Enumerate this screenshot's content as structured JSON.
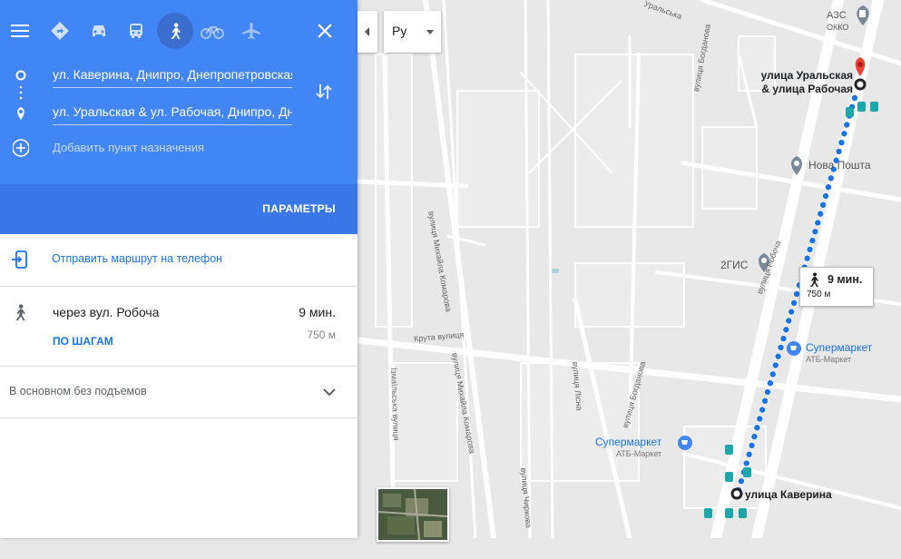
{
  "modes": [
    "directions-icon",
    "car-icon",
    "transit-icon",
    "walk-icon",
    "bike-icon",
    "flight-icon"
  ],
  "route": {
    "origin": "ул. Каверина, Днипро, Днепропетровская",
    "destination": "ул. Уральская & ул. Рабочая, Днипро, Днепропетровская",
    "add_destination": "Добавить пункт назначения",
    "params_label": "ПАРАМЕТРЫ"
  },
  "send": {
    "label": "Отправить маршрут на телефон"
  },
  "result": {
    "via": "через вул. Робоча",
    "time": "9 мин.",
    "distance": "750 м",
    "steps_label": "ПО ШАГАМ"
  },
  "elevation": {
    "label": "В основном без подъемов"
  },
  "map": {
    "lang": "Ру",
    "tooltip_time": "9 мин.",
    "tooltip_dist": "750 м",
    "dest_label_1": "улица Уральская",
    "dest_label_2": "& улица Рабочая",
    "origin_label": "улица Каверина",
    "pois": {
      "azs": "АЗС",
      "okko": "ОККО",
      "novaposhta": "Нова Пошта",
      "gis": "2ГИС",
      "super1": "Супермаркет",
      "super1_sub": "АТБ-Маркет",
      "super2": "Супермаркет",
      "super2_sub": "АТБ-Маркет"
    },
    "streets": {
      "uralska": "Уральська",
      "bogdanova1": "вулиця Богданова",
      "komarova1": "вулиця Михайла Комарова",
      "komarova2": "вулиця Михайла Комарова",
      "kruta": "Крута вулиця",
      "robocha": "вулиця Робоча",
      "lisna": "вулиця Лісна",
      "bogdanova2": "вулиця Богданова",
      "izmail": "Ізмаїльська вулиця",
      "chirkova": "вулиця Чиркова"
    }
  },
  "colors": {
    "header": "#4285f4",
    "route": "#1a73e8",
    "accent": "#1a73e8"
  }
}
